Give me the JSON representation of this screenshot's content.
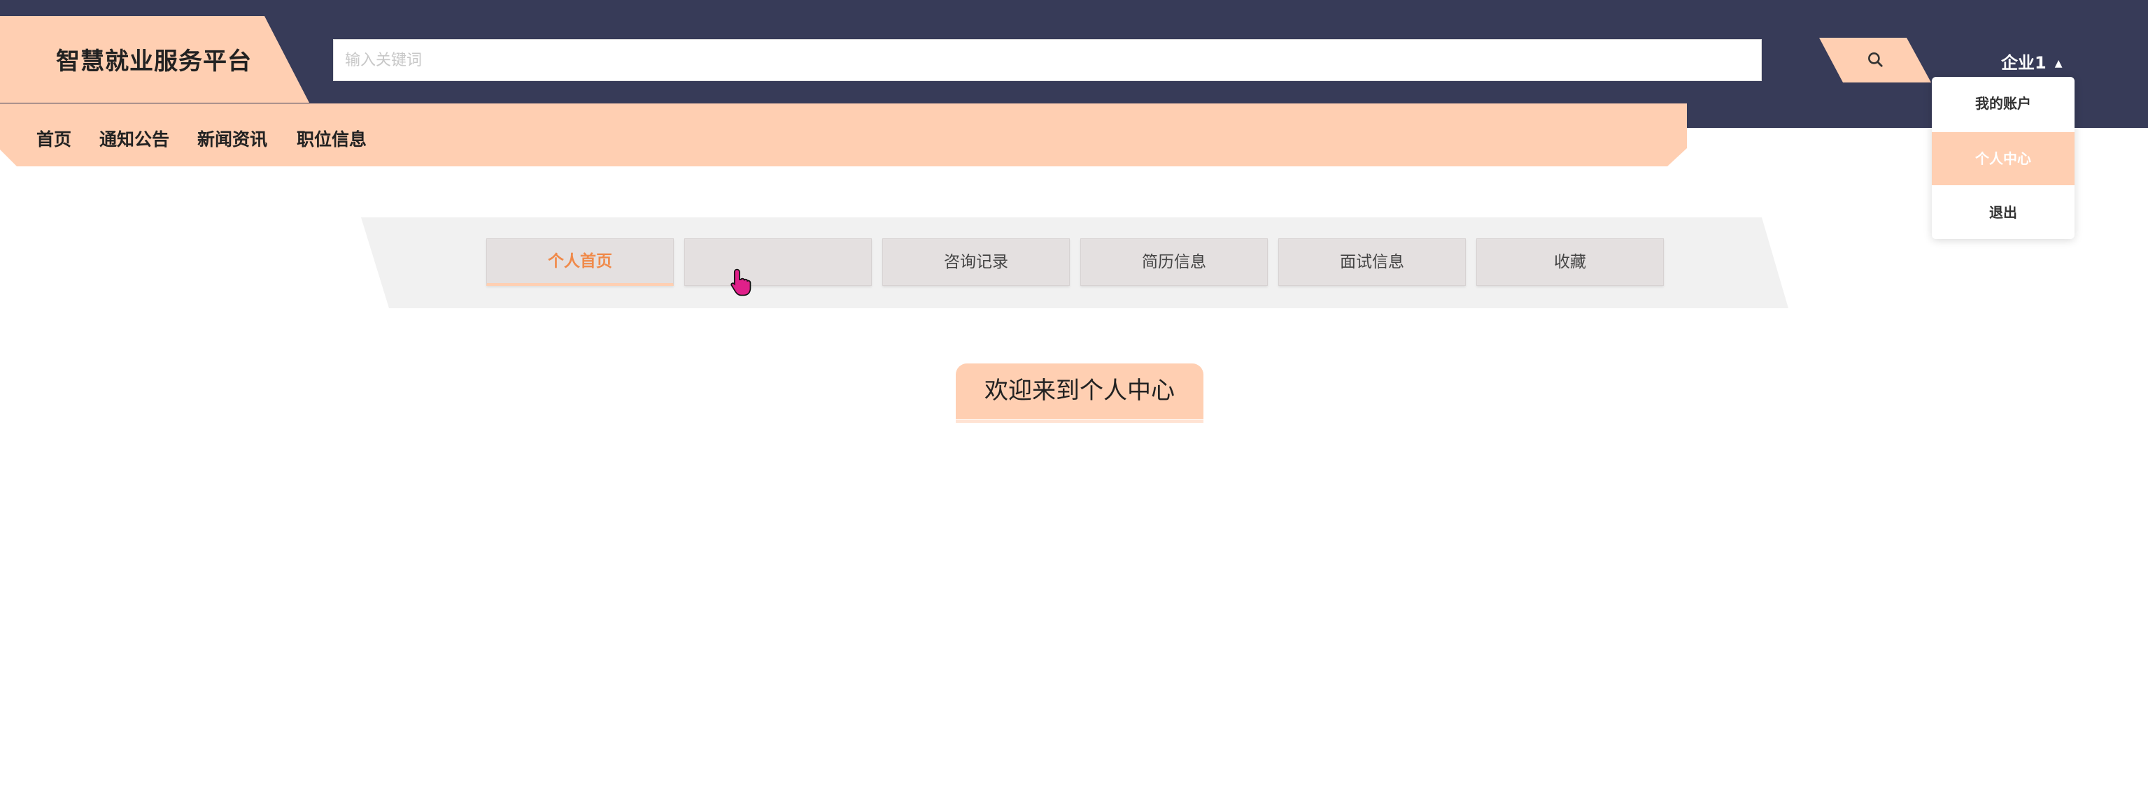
{
  "header": {
    "title": "智慧就业服务平台",
    "search": {
      "placeholder": "输入关键词",
      "value": ""
    },
    "search_icon": "search-icon",
    "user": {
      "name": "企业1",
      "caret": "▲"
    }
  },
  "nav": {
    "items": [
      {
        "label": "首页"
      },
      {
        "label": "通知公告"
      },
      {
        "label": "新闻资讯"
      },
      {
        "label": "职位信息"
      }
    ]
  },
  "user_menu": {
    "items": [
      {
        "label": "我的账户",
        "active": false
      },
      {
        "label": "个人中心",
        "active": true
      },
      {
        "label": "退出",
        "active": false
      }
    ]
  },
  "center_tabs": {
    "items": [
      {
        "label": "个人首页",
        "state": "active"
      },
      {
        "label": "",
        "state": "hover"
      },
      {
        "label": "咨询记录",
        "state": "normal"
      },
      {
        "label": "简历信息",
        "state": "normal"
      },
      {
        "label": "面试信息",
        "state": "normal"
      },
      {
        "label": "收藏",
        "state": "normal"
      }
    ]
  },
  "main": {
    "welcome": "欢迎来到个人中心"
  },
  "colors": {
    "topbar": "#373b58",
    "accent": "#ffcfb2",
    "active_tab_text": "#f08a4a",
    "cursor": "#e0208a"
  }
}
